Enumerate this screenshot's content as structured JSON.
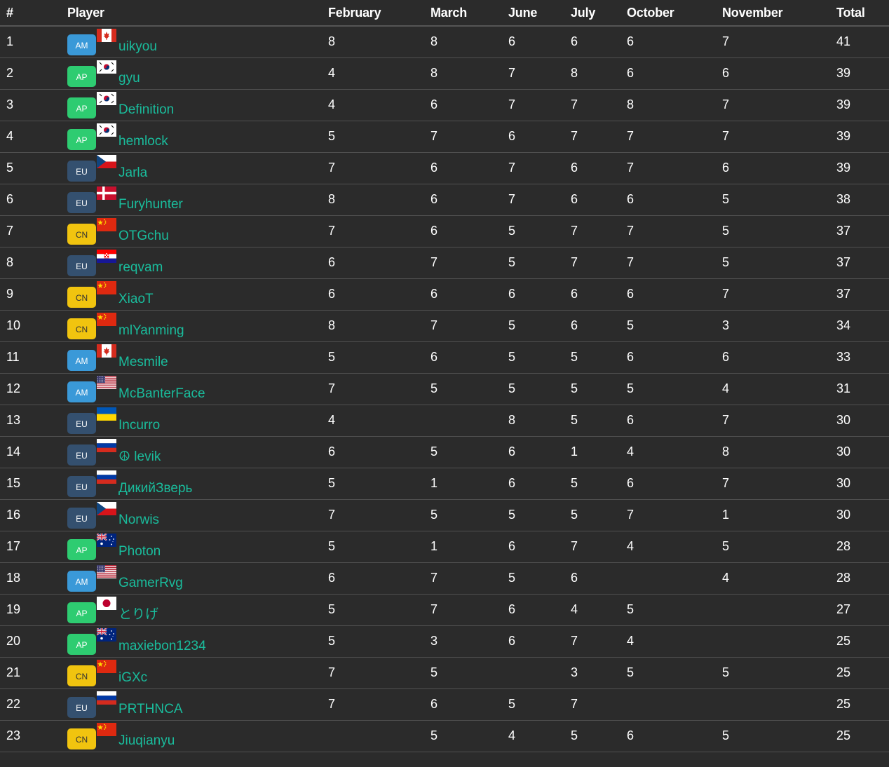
{
  "columns": [
    "#",
    "Player",
    "February",
    "March",
    "June",
    "July",
    "October",
    "November",
    "Total"
  ],
  "colors": {
    "background": "#2b2b2b",
    "player_link": "#1abc9c",
    "AM": "#3a99d8",
    "AP": "#2ecc71",
    "EU": "#34506f",
    "CN": "#f1c40f"
  },
  "rows": [
    {
      "rank": "1",
      "region": "AM",
      "flag": "CA",
      "name": "uikyou",
      "feb": "8",
      "mar": "8",
      "jun": "6",
      "jul": "6",
      "oct": "6",
      "nov": "7",
      "total": "41"
    },
    {
      "rank": "2",
      "region": "AP",
      "flag": "KR",
      "name": "gyu",
      "feb": "4",
      "mar": "8",
      "jun": "7",
      "jul": "8",
      "oct": "6",
      "nov": "6",
      "total": "39"
    },
    {
      "rank": "3",
      "region": "AP",
      "flag": "KR",
      "name": "Definition",
      "feb": "4",
      "mar": "6",
      "jun": "7",
      "jul": "7",
      "oct": "8",
      "nov": "7",
      "total": "39"
    },
    {
      "rank": "4",
      "region": "AP",
      "flag": "KR",
      "name": "hemlock",
      "feb": "5",
      "mar": "7",
      "jun": "6",
      "jul": "7",
      "oct": "7",
      "nov": "7",
      "total": "39"
    },
    {
      "rank": "5",
      "region": "EU",
      "flag": "CZ",
      "name": "Jarla",
      "feb": "7",
      "mar": "6",
      "jun": "7",
      "jul": "6",
      "oct": "7",
      "nov": "6",
      "total": "39"
    },
    {
      "rank": "6",
      "region": "EU",
      "flag": "DK",
      "name": "Furyhunter",
      "feb": "8",
      "mar": "6",
      "jun": "7",
      "jul": "6",
      "oct": "6",
      "nov": "5",
      "total": "38"
    },
    {
      "rank": "7",
      "region": "CN",
      "flag": "CN",
      "name": "OTGchu",
      "feb": "7",
      "mar": "6",
      "jun": "5",
      "jul": "7",
      "oct": "7",
      "nov": "5",
      "total": "37"
    },
    {
      "rank": "8",
      "region": "EU",
      "flag": "HR",
      "name": "reqvam",
      "feb": "6",
      "mar": "7",
      "jun": "5",
      "jul": "7",
      "oct": "7",
      "nov": "5",
      "total": "37"
    },
    {
      "rank": "9",
      "region": "CN",
      "flag": "CN",
      "name": "XiaoT",
      "feb": "6",
      "mar": "6",
      "jun": "6",
      "jul": "6",
      "oct": "6",
      "nov": "7",
      "total": "37"
    },
    {
      "rank": "10",
      "region": "CN",
      "flag": "CN",
      "name": "mlYanming",
      "feb": "8",
      "mar": "7",
      "jun": "5",
      "jul": "6",
      "oct": "5",
      "nov": "3",
      "total": "34"
    },
    {
      "rank": "11",
      "region": "AM",
      "flag": "CA",
      "name": "Mesmile",
      "feb": "5",
      "mar": "6",
      "jun": "5",
      "jul": "5",
      "oct": "6",
      "nov": "6",
      "total": "33"
    },
    {
      "rank": "12",
      "region": "AM",
      "flag": "US",
      "name": "McBanterFace",
      "feb": "7",
      "mar": "5",
      "jun": "5",
      "jul": "5",
      "oct": "5",
      "nov": "4",
      "total": "31"
    },
    {
      "rank": "13",
      "region": "EU",
      "flag": "UA",
      "name": "Incurro",
      "feb": "4",
      "mar": "",
      "jun": "8",
      "jul": "5",
      "oct": "6",
      "nov": "7",
      "total": "30"
    },
    {
      "rank": "14",
      "region": "EU",
      "flag": "RU",
      "name": "☮ levik",
      "feb": "6",
      "mar": "5",
      "jun": "6",
      "jul": "1",
      "oct": "4",
      "nov": "8",
      "total": "30"
    },
    {
      "rank": "15",
      "region": "EU",
      "flag": "RU",
      "name": "ДикийЗверь",
      "feb": "5",
      "mar": "1",
      "jun": "6",
      "jul": "5",
      "oct": "6",
      "nov": "7",
      "total": "30"
    },
    {
      "rank": "16",
      "region": "EU",
      "flag": "CZ",
      "name": "Norwis",
      "feb": "7",
      "mar": "5",
      "jun": "5",
      "jul": "5",
      "oct": "7",
      "nov": "1",
      "total": "30"
    },
    {
      "rank": "17",
      "region": "AP",
      "flag": "AU",
      "name": "Photon",
      "feb": "5",
      "mar": "1",
      "jun": "6",
      "jul": "7",
      "oct": "4",
      "nov": "5",
      "total": "28"
    },
    {
      "rank": "18",
      "region": "AM",
      "flag": "US",
      "name": "GamerRvg",
      "feb": "6",
      "mar": "7",
      "jun": "5",
      "jul": "6",
      "oct": "",
      "nov": "4",
      "total": "28"
    },
    {
      "rank": "19",
      "region": "AP",
      "flag": "JP",
      "name": "とりげ",
      "feb": "5",
      "mar": "7",
      "jun": "6",
      "jul": "4",
      "oct": "5",
      "nov": "",
      "total": "27"
    },
    {
      "rank": "20",
      "region": "AP",
      "flag": "AU",
      "name": "maxiebon1234",
      "feb": "5",
      "mar": "3",
      "jun": "6",
      "jul": "7",
      "oct": "4",
      "nov": "",
      "total": "25"
    },
    {
      "rank": "21",
      "region": "CN",
      "flag": "CN",
      "name": "iGXc",
      "feb": "7",
      "mar": "5",
      "jun": "",
      "jul": "3",
      "oct": "5",
      "nov": "5",
      "total": "25"
    },
    {
      "rank": "22",
      "region": "EU",
      "flag": "RU",
      "name": "PRTHNCA",
      "feb": "7",
      "mar": "6",
      "jun": "5",
      "jul": "7",
      "oct": "",
      "nov": "",
      "total": "25"
    },
    {
      "rank": "23",
      "region": "CN",
      "flag": "CN",
      "name": "Jiuqianyu",
      "feb": "",
      "mar": "5",
      "jun": "4",
      "jul": "5",
      "oct": "6",
      "nov": "5",
      "total": "25"
    }
  ]
}
